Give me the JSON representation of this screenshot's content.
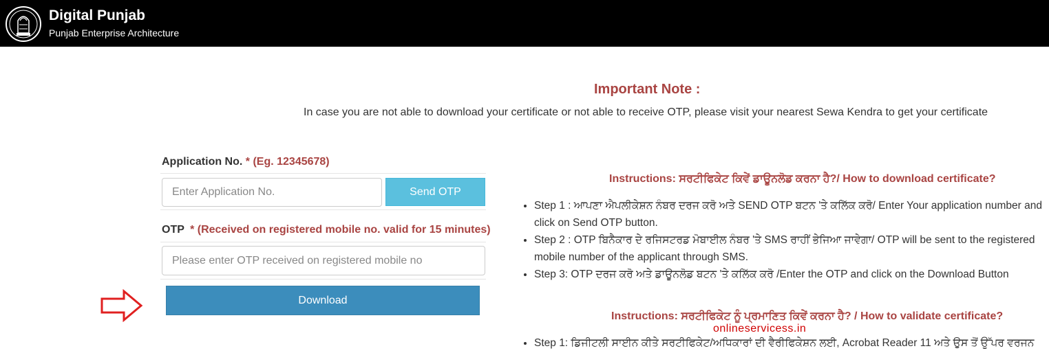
{
  "header": {
    "title": "Digital Punjab",
    "subtitle": "Punjab Enterprise Architecture",
    "logo_icon": "state-emblem-icon"
  },
  "note": {
    "title": "Important Note :",
    "text": "In case you are not able to download your certificate or not able to receive OTP, please visit your nearest Sewa Kendra to get your certificate"
  },
  "form": {
    "application_label": "Application No.",
    "application_required": "* (Eg. 12345678)",
    "application_placeholder": "Enter Application No.",
    "send_otp_label": "Send OTP",
    "otp_label": "OTP",
    "otp_required": "* (Received on registered mobile no. valid for 15 minutes)",
    "otp_placeholder": "Please enter OTP received on registered mobile no",
    "download_label": "Download"
  },
  "instructions_download": {
    "title": "Instructions: ਸਰਟੀਫਿਕੇਟ ਕਿਵੇਂ ਡਾਊਨਲੋਡ ਕਰਨਾ ਹੈ?/ How to download certificate?",
    "steps": [
      "Step 1 : ਆਪਣਾ ਐਪਲੀਕੇਸ਼ਨ ਨੰਬਰ ਦਰਜ ਕਰੋ ਅਤੇ SEND OTP ਬਟਨ 'ਤੇ ਕਲਿੱਕ ਕਰੋ/ Enter Your application number and click on Send OTP button.",
      "Step 2 : OTP ਬਿਨੈਕਾਰ ਦੇ ਰਜਿਸਟਰਡ ਮੋਬਾਈਲ ਨੰਬਰ 'ਤੇ SMS ਰਾਹੀਂ ਭੇਜਿਆ ਜਾਵੇਗਾ/ OTP will be sent to the registered mobile number of the applicant through SMS.",
      "Step 3: OTP ਦਰਜ ਕਰੋ ਅਤੇ ਡਾਊਨਲੋਡ ਬਟਨ 'ਤੇ ਕਲਿੱਕ ਕਰੋ /Enter the OTP and click on the Download Button"
    ]
  },
  "instructions_validate": {
    "title": "Instructions: ਸਰਟੀਫਿਕੇਟ ਨੂੰ ਪ੍ਰਮਾਣਿਤ ਕਿਵੇਂ ਕਰਨਾ ਹੈ? / How to validate certificate?",
    "steps": [
      "Step 1: ਡਿਜੀਟਲੀ ਸਾਈਨ ਕੀਤੇ ਸਰਟੀਫਿਕੇਟ/ਅਧਿਕਾਰਾਂ ਦੀ ਵੈਰੀਫਿਕੇਸ਼ਨ ਲਈ, Acrobat Reader 11 ਅਤੇ ਉਸ ਤੋਂ ਉੱਪਰ ਵਰਜਨ"
    ]
  },
  "watermark": "onlineservicess.in",
  "colors": {
    "header_bg": "#000000",
    "accent_red": "#a94442",
    "otp_button": "#5bc0de",
    "download_button": "#3c8dbc",
    "arrow": "#e02020"
  }
}
